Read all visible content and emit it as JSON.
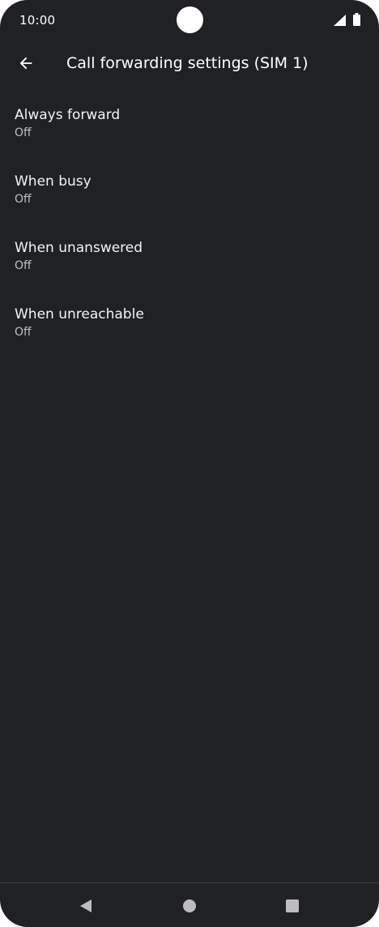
{
  "status_bar": {
    "time": "10:00",
    "icons": [
      "signal-icon",
      "battery-icon"
    ]
  },
  "app_bar": {
    "back_icon": "arrow-back-icon",
    "title": "Call forwarding settings (SIM 1)"
  },
  "items": [
    {
      "title": "Always forward",
      "summary": "Off"
    },
    {
      "title": "When busy",
      "summary": "Off"
    },
    {
      "title": "When unanswered",
      "summary": "Off"
    },
    {
      "title": "When unreachable",
      "summary": "Off"
    }
  ],
  "nav_bar": {
    "icons": [
      "nav-back-icon",
      "nav-home-icon",
      "nav-recents-icon"
    ]
  },
  "colors": {
    "background": "#202124",
    "text_primary": "#f1f3f4",
    "text_secondary": "#bdc1c6"
  }
}
